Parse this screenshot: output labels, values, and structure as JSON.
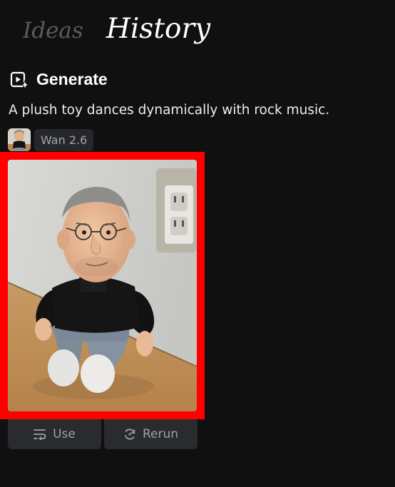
{
  "tabs": [
    {
      "label": "Ideas",
      "active": false
    },
    {
      "label": "History",
      "active": true
    }
  ],
  "generation": {
    "title": "Generate",
    "prompt": "A plush toy dances dynamically with rock music.",
    "model": "Wan 2.6"
  },
  "actions": {
    "use_label": "Use",
    "rerun_label": "Rerun"
  },
  "icons": {
    "generate": "video-sparkle-icon",
    "use": "lines-wrap-icon",
    "rerun": "refresh-sparkle-icon"
  },
  "colors": {
    "background": "#101010",
    "selection_outline": "#ff0000",
    "button_bg": "#2a2b2f",
    "chip_bg": "#26272b"
  }
}
